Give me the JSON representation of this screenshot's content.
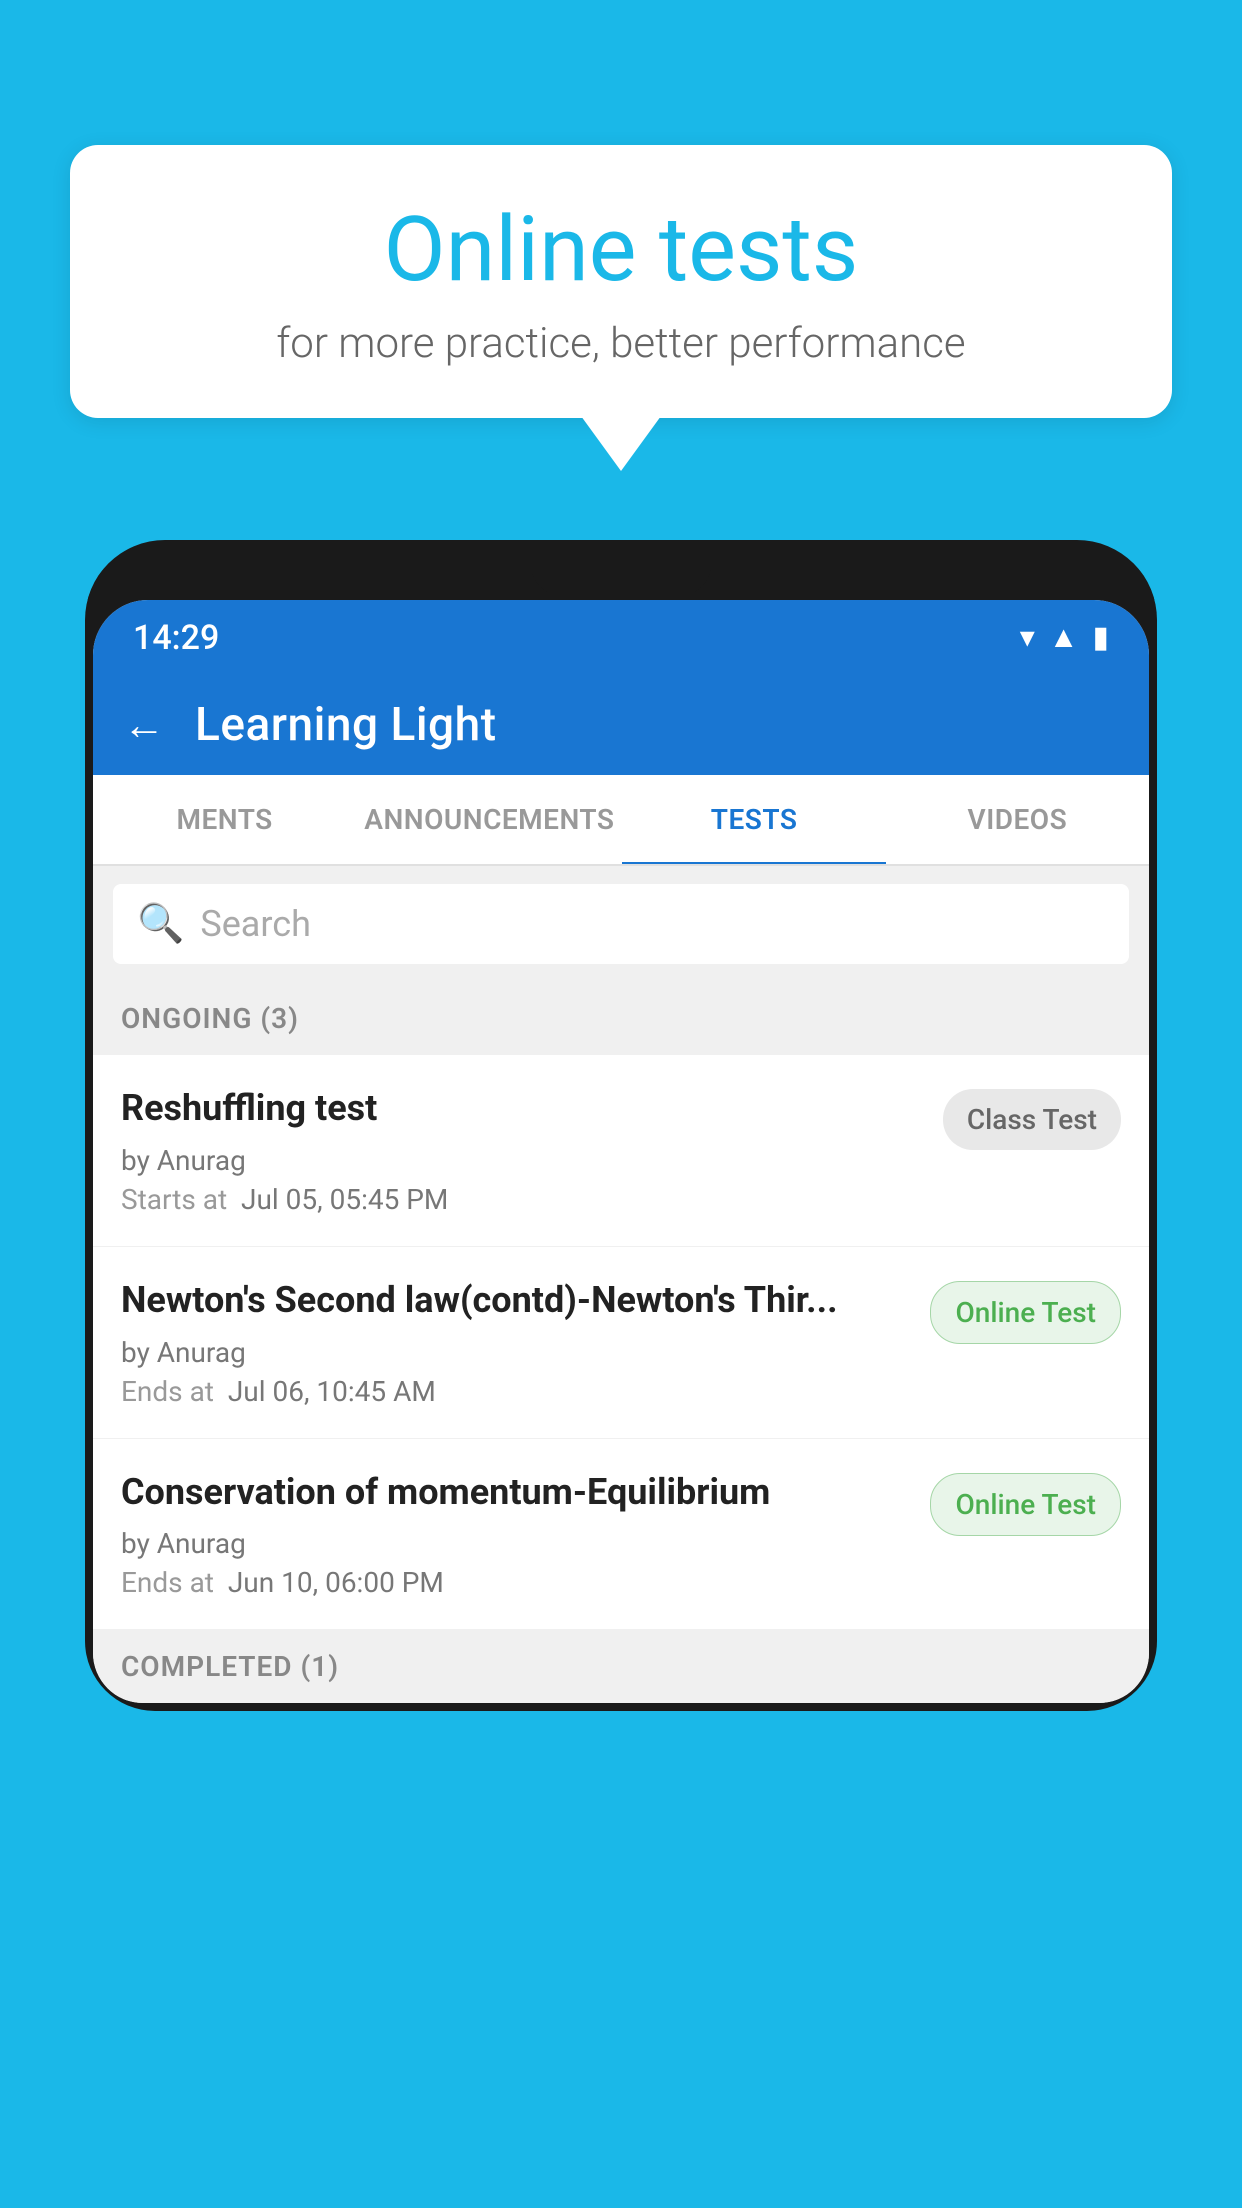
{
  "background_color": "#1ab8e8",
  "speech_bubble": {
    "title": "Online tests",
    "subtitle": "for more practice, better performance"
  },
  "phone": {
    "status_bar": {
      "time": "14:29",
      "icons": [
        "wifi",
        "signal",
        "battery"
      ]
    },
    "app_header": {
      "back_label": "←",
      "title": "Learning Light"
    },
    "tabs": [
      {
        "label": "MENTS",
        "active": false
      },
      {
        "label": "ANNOUNCEMENTS",
        "active": false
      },
      {
        "label": "TESTS",
        "active": true
      },
      {
        "label": "VIDEOS",
        "active": false
      }
    ],
    "search": {
      "placeholder": "Search"
    },
    "ongoing_section": {
      "header": "ONGOING (3)",
      "tests": [
        {
          "title": "Reshuffling test",
          "by": "by Anurag",
          "time_label": "Starts at",
          "time": "Jul 05, 05:45 PM",
          "badge": "Class Test",
          "badge_type": "class"
        },
        {
          "title": "Newton's Second law(contd)-Newton's Thir...",
          "by": "by Anurag",
          "time_label": "Ends at",
          "time": "Jul 06, 10:45 AM",
          "badge": "Online Test",
          "badge_type": "online"
        },
        {
          "title": "Conservation of momentum-Equilibrium",
          "by": "by Anurag",
          "time_label": "Ends at",
          "time": "Jun 10, 06:00 PM",
          "badge": "Online Test",
          "badge_type": "online"
        }
      ]
    },
    "completed_section": {
      "header": "COMPLETED (1)"
    }
  }
}
